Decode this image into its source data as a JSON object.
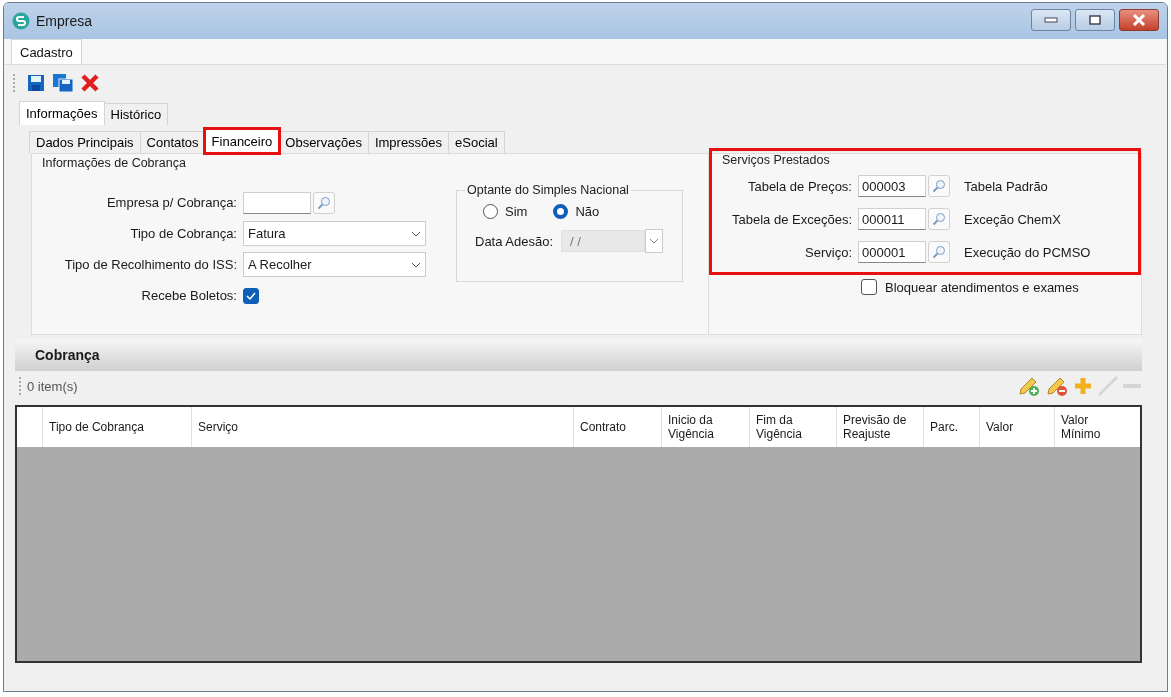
{
  "window": {
    "title": "Empresa"
  },
  "menu_tabs": [
    {
      "label": "Cadastro",
      "selected": true
    }
  ],
  "toolbar": [
    {
      "kind": "save"
    },
    {
      "kind": "save-all"
    },
    {
      "kind": "delete"
    }
  ],
  "outer_tabs": [
    {
      "label": "Informações",
      "selected": true
    },
    {
      "label": "Histórico",
      "selected": false
    }
  ],
  "inner_tabs": [
    {
      "label": "Dados Principais",
      "selected": false,
      "highlighted": false
    },
    {
      "label": "Contatos",
      "selected": false,
      "highlighted": false
    },
    {
      "label": "Financeiro",
      "selected": true,
      "highlighted": true
    },
    {
      "label": "Observações",
      "selected": false,
      "highlighted": false
    },
    {
      "label": "Impressões",
      "selected": false,
      "highlighted": false
    },
    {
      "label": "eSocial",
      "selected": false,
      "highlighted": false
    }
  ],
  "cobranca_info": {
    "title": "Informações de Cobrança",
    "fields": [
      {
        "kind": "lookup",
        "label": "Empresa p/ Cobrança:"
      },
      {
        "kind": "select",
        "label": "Tipo de Cobrança:",
        "value": "Fatura"
      },
      {
        "kind": "select",
        "label": "Tipo de Recolhimento do ISS:",
        "value": "A Recolher"
      },
      {
        "kind": "checkbox",
        "label": "Recebe Boletos:",
        "checked": true
      }
    ]
  },
  "simples_nacional": {
    "title": "Optante do Simples Nacional",
    "options": [
      {
        "label": "Sim",
        "selected": false
      },
      {
        "label": "Não",
        "selected": true
      }
    ],
    "date_label": "Data Adesão:",
    "date_value": "/ /",
    "date_disabled": true
  },
  "servicos": {
    "title": "Serviços Prestados",
    "highlighted": true,
    "fields": [
      {
        "label": "Tabela de Preços:",
        "code": "000003",
        "description": "Tabela Padrão"
      },
      {
        "label": "Tabela de Exceções:",
        "code": "000011",
        "description": "Exceção ChemX"
      },
      {
        "label": "Serviço:",
        "code": "000001",
        "description": "Execução do PCMSO"
      }
    ]
  },
  "bloquear": {
    "label": "Bloquear atendimentos e exames",
    "checked": false
  },
  "cobranca": {
    "title": "Cobrança",
    "count": "0 item(s)",
    "actions": [
      {
        "kind": "edit-add",
        "disabled": false
      },
      {
        "kind": "edit-remove",
        "disabled": false
      },
      {
        "kind": "add",
        "disabled": false
      },
      {
        "kind": "edit",
        "disabled": true
      },
      {
        "kind": "remove",
        "disabled": true
      }
    ],
    "columns": [
      "Tipo de Cobrança",
      "Serviço",
      "Contrato",
      "Inicio da Vigência",
      "Fim da Vigência",
      "Previsão de Reajuste",
      "Parc.",
      "Valor",
      "Valor Mínimo"
    ]
  }
}
